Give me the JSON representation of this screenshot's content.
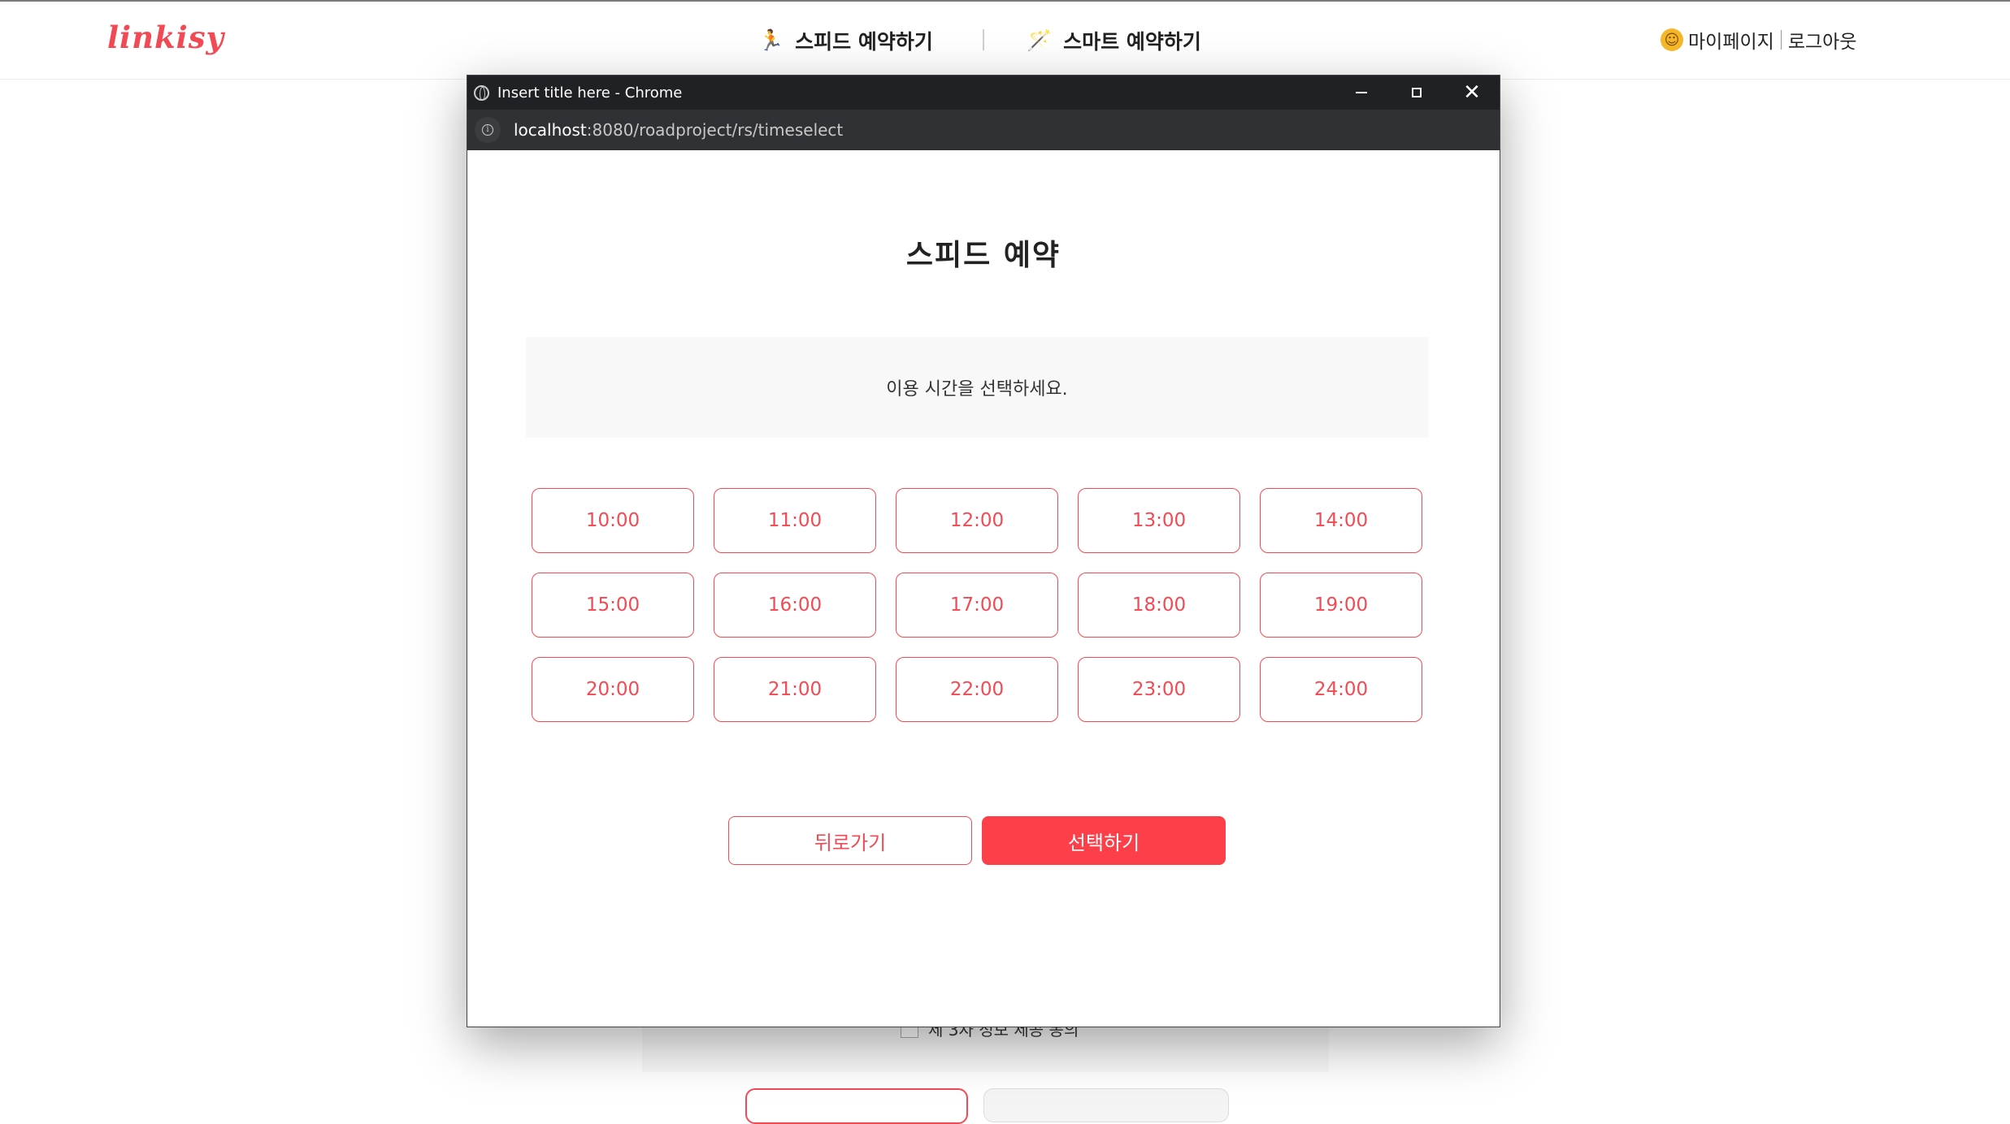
{
  "site": {
    "logo": "linkisy",
    "nav": [
      {
        "icon": "🏃",
        "label": "스피드 예약하기"
      },
      {
        "icon": "🪄",
        "label": "스마트 예약하기"
      }
    ],
    "user": {
      "icon": "🙂",
      "mypage": "마이페이지",
      "logout": "로그아웃"
    },
    "bg_checkbox_label": "제 3자 정보 제공 동의"
  },
  "popup": {
    "window_title": "Insert title here - Chrome",
    "url_host": "localhost",
    "url_path": ":8080/roadproject/rs/timeselect",
    "page_title": "스피드 예약",
    "notice": "이용 시간을 선택하세요.",
    "times": [
      "10:00",
      "11:00",
      "12:00",
      "13:00",
      "14:00",
      "15:00",
      "16:00",
      "17:00",
      "18:00",
      "19:00",
      "20:00",
      "21:00",
      "22:00",
      "23:00",
      "24:00"
    ],
    "back_label": "뒤로가기",
    "select_label": "선택하기"
  },
  "colors": {
    "accent": "#f24a55",
    "select_button": "#fd3f4a",
    "titlebar": "#202124",
    "addressbar": "#303134"
  }
}
